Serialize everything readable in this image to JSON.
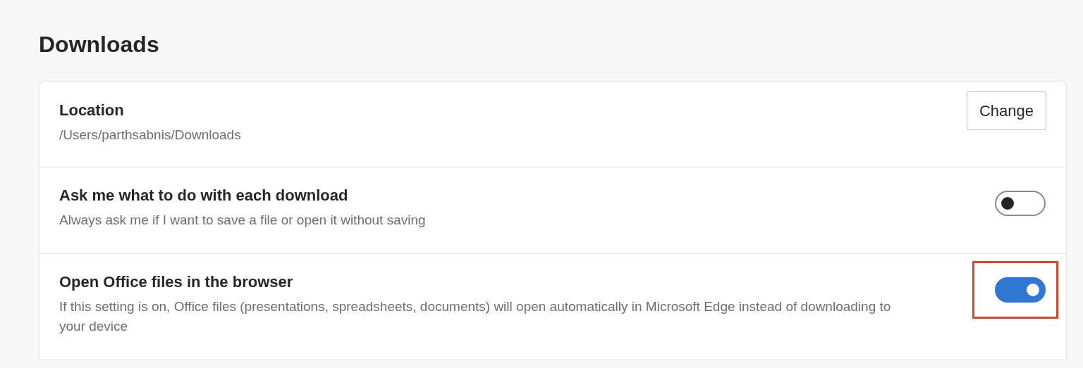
{
  "section": {
    "title": "Downloads"
  },
  "settings": [
    {
      "kind": "button",
      "title": "Location",
      "description": "/Users/parthsabnis/Downloads",
      "button": "Change"
    },
    {
      "kind": "toggle",
      "title": "Ask me what to do with each download",
      "description": "Always ask me if I want to save a file or open it without saving",
      "on": false,
      "highlighted": false
    },
    {
      "kind": "toggle",
      "title": "Open Office files in the browser",
      "description": "If this setting is on, Office files (presentations, spreadsheets, documents) will open automatically in Microsoft Edge instead of downloading to your device",
      "on": true,
      "highlighted": true
    }
  ]
}
